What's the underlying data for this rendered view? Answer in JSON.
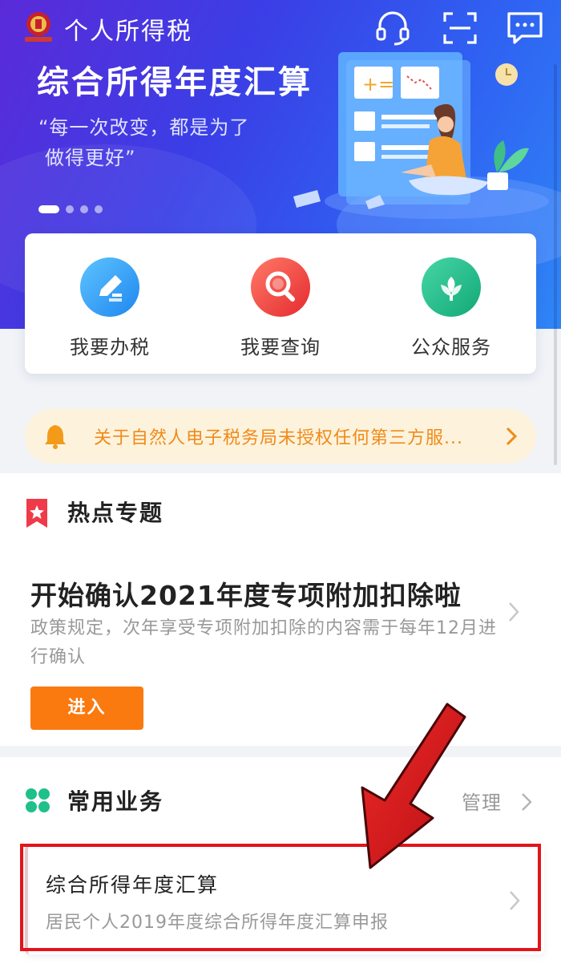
{
  "header": {
    "title": "个人所得税"
  },
  "banner": {
    "headline": "综合所得年度汇算",
    "quote_line1": "“每一次改变，都是为了",
    "quote_line2": "做得更好”",
    "page_indicator": {
      "count": 4,
      "active": 1
    }
  },
  "quick_actions": [
    {
      "label": "我要办税",
      "icon": "pen-icon",
      "color": "#2a9af0"
    },
    {
      "label": "我要查询",
      "icon": "search-icon",
      "color": "#f0413c"
    },
    {
      "label": "公众服务",
      "icon": "flower-icon",
      "color": "#22b98a"
    }
  ],
  "notice": {
    "text": "关于自然人电子税务局未授权任何第三方服..."
  },
  "hot_topics": {
    "title": "热点专题",
    "topic_title": "开始确认2021年度专项附加扣除啦",
    "topic_desc": "政策规定，次年享受专项附加扣除的内容需于每年12月进行确认",
    "button_label": "进入"
  },
  "common_business": {
    "title": "常用业务",
    "manage_label": "管理",
    "items": [
      {
        "title": "综合所得年度汇算",
        "subtitle": "居民个人2019年度综合所得年度汇算申报"
      }
    ]
  },
  "colors": {
    "accent_orange": "#fa7a10",
    "notice_text": "#f08a1a",
    "highlight_red": "#e3141b"
  }
}
